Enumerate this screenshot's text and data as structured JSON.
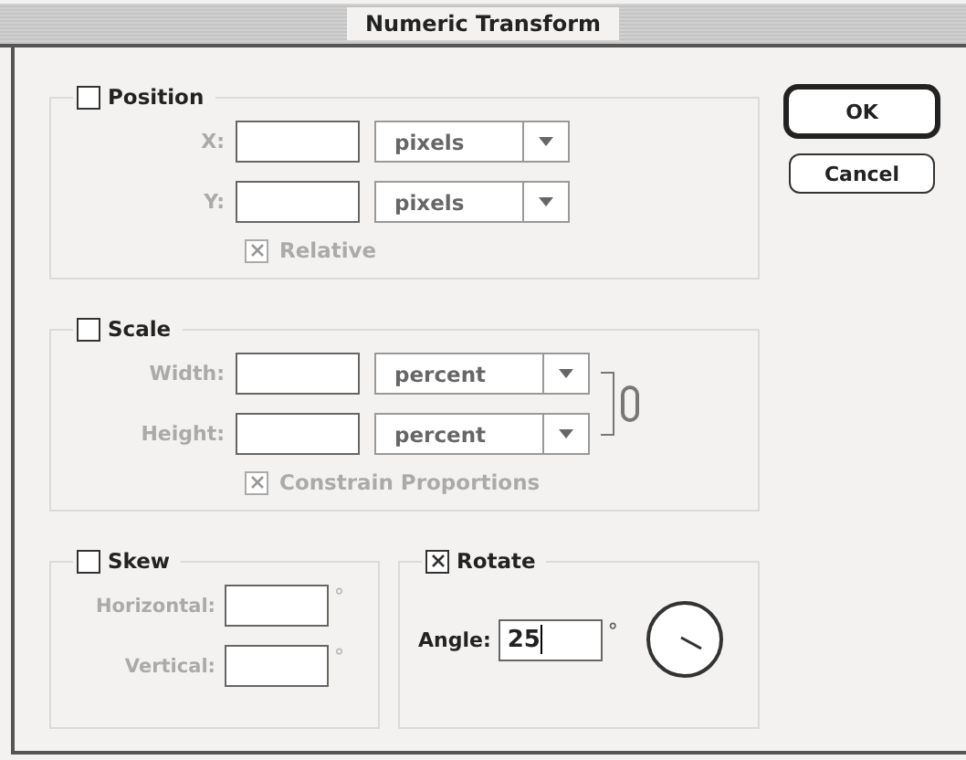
{
  "window": {
    "title": "Numeric Transform"
  },
  "groups": [
    {
      "kind": "position",
      "label": "Position",
      "checked": false,
      "fields": [
        {
          "label": "X:",
          "unit": "pixels",
          "disabled": true
        },
        {
          "label": "Y:",
          "unit": "pixels",
          "disabled": true
        }
      ],
      "option": {
        "label": "Relative",
        "checked": true,
        "disabled": true
      }
    },
    {
      "kind": "scale",
      "label": "Scale",
      "checked": false,
      "fields": [
        {
          "label": "Width:",
          "unit": "percent",
          "disabled": true
        },
        {
          "label": "Height:",
          "unit": "percent",
          "disabled": true
        }
      ],
      "option": {
        "label": "Constrain Proportions",
        "checked": true,
        "disabled": true
      }
    },
    {
      "kind": "skew",
      "label": "Skew",
      "checked": false,
      "fields": [
        {
          "label": "Horizontal:",
          "suffix": "°",
          "disabled": true
        },
        {
          "label": "Vertical:",
          "suffix": "°",
          "disabled": true
        }
      ]
    },
    {
      "kind": "rotate",
      "label": "Rotate",
      "checked": true,
      "fields": [
        {
          "label": "Angle:",
          "value": "25",
          "suffix": "°",
          "disabled": false
        }
      ]
    }
  ],
  "buttons": [
    {
      "label": "OK",
      "default": true
    },
    {
      "label": "Cancel",
      "default": false
    }
  ]
}
